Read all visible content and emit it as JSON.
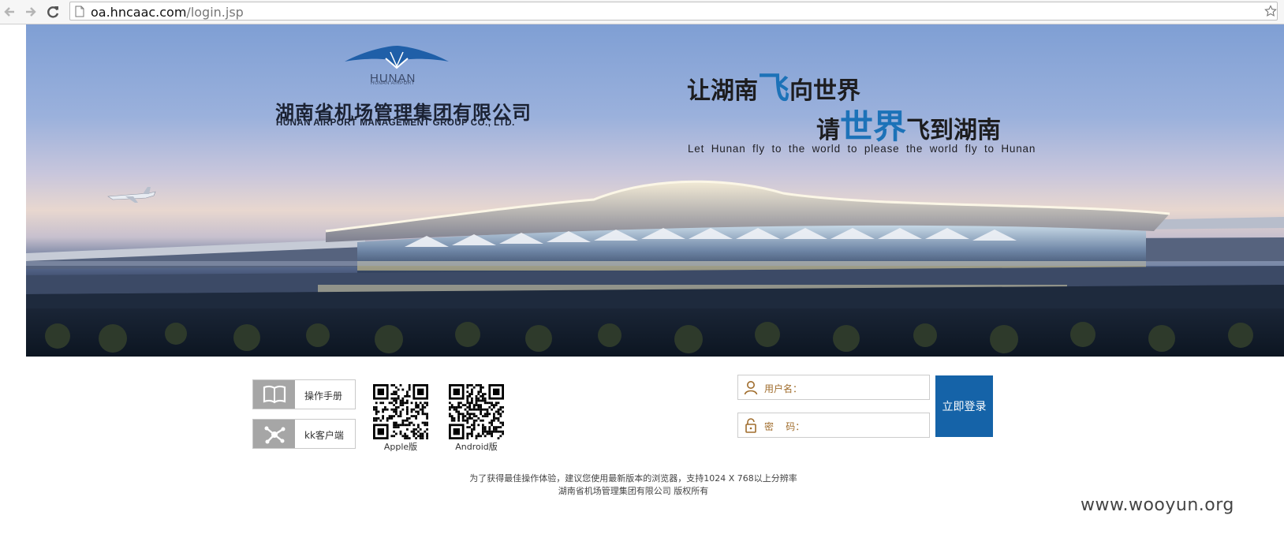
{
  "browser": {
    "url_host": "oa.hncaac.com",
    "url_path": "/login.jsp"
  },
  "banner": {
    "logo_text": "HUNAN",
    "logo_subtext": "HUNAN AIRPORT",
    "company_cn": "湖南省机场管理集团有限公司",
    "company_en": "HUNAN AIRPORT MANAGEMENT GROUP CO., LTD.",
    "slogan1_pre": "让湖南",
    "slogan1_hl": "飞",
    "slogan1_post": "向世界",
    "slogan2_pre": "请",
    "slogan2_hl": "世界",
    "slogan2_post": "飞到湖南",
    "slogan_en": "Let Hunan fly to the world to please the world fly to Hunan"
  },
  "tools": {
    "manual_label": "操作手册",
    "kk_label": "kk客户端"
  },
  "downloads": {
    "apple_label": "Apple版",
    "android_label": "Android版"
  },
  "login": {
    "username_label": "用户名：",
    "password_label": "密    码：",
    "submit_label": "立即登录"
  },
  "footer": {
    "line1": "为了获得最佳操作体验，建议您使用最新版本的浏览器，支持1024 X 768以上分辨率",
    "line2": "湖南省机场管理集团有限公司 版权所有"
  },
  "watermark": "www.wooyun.org",
  "colors": {
    "accent_blue": "#1563a8",
    "slogan_blue": "#1c72b8",
    "label_brown": "#a06d2d"
  }
}
